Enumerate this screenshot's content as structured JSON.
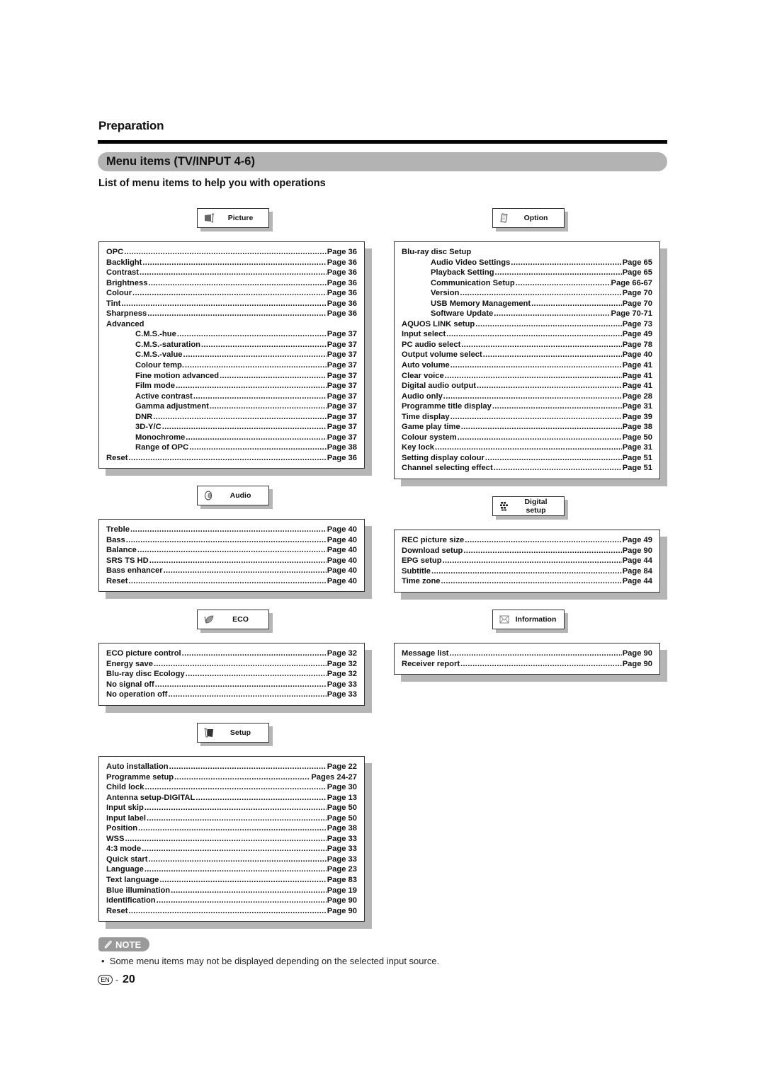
{
  "header": {
    "section": "Preparation",
    "title": "Menu items (TV/INPUT 4-6)",
    "subtitle": "List of menu items to help you with operations"
  },
  "menus": {
    "picture": {
      "label": "Picture",
      "icon": "picture-icon",
      "items": [
        {
          "name": "OPC",
          "page": "Page 36"
        },
        {
          "name": "Backlight",
          "page": "Page 36"
        },
        {
          "name": "Contrast",
          "page": "Page 36"
        },
        {
          "name": "Brightness",
          "page": "Page 36"
        },
        {
          "name": "Colour",
          "page": "Page 36"
        },
        {
          "name": "Tint",
          "page": "Page 36"
        },
        {
          "name": "Sharpness",
          "page": "Page 36"
        },
        {
          "name": "Advanced",
          "page": "",
          "header": true
        },
        {
          "name": "C.M.S.-hue",
          "page": "Page 37",
          "indent": true
        },
        {
          "name": "C.M.S.-saturation",
          "page": "Page 37",
          "indent": true
        },
        {
          "name": "C.M.S.-value",
          "page": "Page 37",
          "indent": true
        },
        {
          "name": "Colour temp.",
          "page": "Page 37",
          "indent": true
        },
        {
          "name": "Fine motion advanced",
          "page": "Page 37",
          "indent": true
        },
        {
          "name": "Film mode",
          "page": "Page 37",
          "indent": true
        },
        {
          "name": "Active contrast",
          "page": "Page 37",
          "indent": true
        },
        {
          "name": "Gamma adjustment",
          "page": "Page 37",
          "indent": true
        },
        {
          "name": "DNR",
          "page": "Page 37",
          "indent": true
        },
        {
          "name": "3D-Y/C",
          "page": "Page 37",
          "indent": true
        },
        {
          "name": "Monochrome",
          "page": "Page 37",
          "indent": true
        },
        {
          "name": "Range of OPC",
          "page": "Page 38",
          "indent": true
        },
        {
          "name": "Reset",
          "page": "Page 36"
        }
      ]
    },
    "audio": {
      "label": "Audio",
      "icon": "speaker-icon",
      "items": [
        {
          "name": "Treble",
          "page": "Page 40"
        },
        {
          "name": "Bass",
          "page": "Page 40"
        },
        {
          "name": "Balance",
          "page": "Page 40"
        },
        {
          "name": "SRS TS HD",
          "page": "Page 40"
        },
        {
          "name": "Bass enhancer",
          "page": "Page 40"
        },
        {
          "name": "Reset",
          "page": "Page 40"
        }
      ]
    },
    "eco": {
      "label": "ECO",
      "icon": "leaf-icon",
      "items": [
        {
          "name": "ECO picture control",
          "page": "Page 32"
        },
        {
          "name": "Energy save",
          "page": "Page 32"
        },
        {
          "name": "Blu-ray disc Ecology",
          "page": "Page 32"
        },
        {
          "name": "No signal off",
          "page": "Page 33"
        },
        {
          "name": "No operation off",
          "page": "Page 33"
        }
      ]
    },
    "setup": {
      "label": "Setup",
      "icon": "wrench-icon",
      "items": [
        {
          "name": "Auto installation",
          "page": "Page 22"
        },
        {
          "name": "Programme setup",
          "page": "Pages 24-27"
        },
        {
          "name": "Child lock",
          "page": "Page 30"
        },
        {
          "name": "Antenna setup-DIGITAL",
          "page": "Page 13"
        },
        {
          "name": "Input skip",
          "page": "Page 50"
        },
        {
          "name": "Input label",
          "page": "Page 50"
        },
        {
          "name": "Position",
          "page": "Page 38"
        },
        {
          "name": "WSS",
          "page": "Page 33"
        },
        {
          "name": "4:3 mode",
          "page": "Page 33"
        },
        {
          "name": "Quick start",
          "page": "Page 33"
        },
        {
          "name": "Language",
          "page": "Page 23"
        },
        {
          "name": "Text language",
          "page": "Page 83"
        },
        {
          "name": "Blue illumination",
          "page": "Page 19"
        },
        {
          "name": "Identification",
          "page": "Page 90"
        },
        {
          "name": "Reset",
          "page": "Page 90"
        }
      ]
    },
    "option": {
      "label": "Option",
      "icon": "option-icon",
      "items": [
        {
          "name": "Blu-ray disc Setup",
          "page": "",
          "header": true
        },
        {
          "name": "Audio Video Settings",
          "page": "Page 65",
          "indent": true
        },
        {
          "name": "Playback Setting",
          "page": "Page 65",
          "indent": true
        },
        {
          "name": "Communication Setup",
          "page": "Page 66-67",
          "indent": true
        },
        {
          "name": "Version",
          "page": "Page 70",
          "indent": true
        },
        {
          "name": "USB Memory Management",
          "page": "Page 70",
          "indent": true
        },
        {
          "name": "Software Update",
          "page": "Page 70-71",
          "indent": true
        },
        {
          "name": "AQUOS LINK setup",
          "page": "Page 73"
        },
        {
          "name": "Input select",
          "page": "Page 49"
        },
        {
          "name": "PC audio select",
          "page": "Page 78"
        },
        {
          "name": "Output volume select",
          "page": "Page 40"
        },
        {
          "name": "Auto volume",
          "page": "Page 41"
        },
        {
          "name": "Clear voice",
          "page": "Page 41"
        },
        {
          "name": "Digital audio output",
          "page": "Page 41"
        },
        {
          "name": "Audio only",
          "page": "Page 28"
        },
        {
          "name": "Programme title display",
          "page": "Page 31"
        },
        {
          "name": "Time display",
          "page": "Page 39"
        },
        {
          "name": "Game play time",
          "page": "Page 38"
        },
        {
          "name": "Colour system",
          "page": "Page 50"
        },
        {
          "name": "Key lock",
          "page": "Page 31"
        },
        {
          "name": "Setting display colour",
          "page": "Page 51"
        },
        {
          "name": "Channel selecting effect",
          "page": "Page 51"
        }
      ]
    },
    "digital": {
      "label": "Digital setup",
      "icon": "digital-grid-icon",
      "items": [
        {
          "name": "REC picture size",
          "page": "Page 49"
        },
        {
          "name": "Download setup",
          "page": "Page 90"
        },
        {
          "name": "EPG setup",
          "page": "Page 44"
        },
        {
          "name": "Subtitle",
          "page": "Page 84"
        },
        {
          "name": "Time zone",
          "page": "Page 44"
        }
      ]
    },
    "information": {
      "label": "Information",
      "icon": "envelope-icon",
      "items": [
        {
          "name": "Message list",
          "page": "Page 90"
        },
        {
          "name": "Receiver report",
          "page": "Page 90"
        }
      ]
    }
  },
  "note": {
    "badge": "NOTE",
    "text": "Some menu items may not be displayed depending on the selected input source."
  },
  "footer": {
    "lang_badge": "EN",
    "page_number": "20"
  }
}
